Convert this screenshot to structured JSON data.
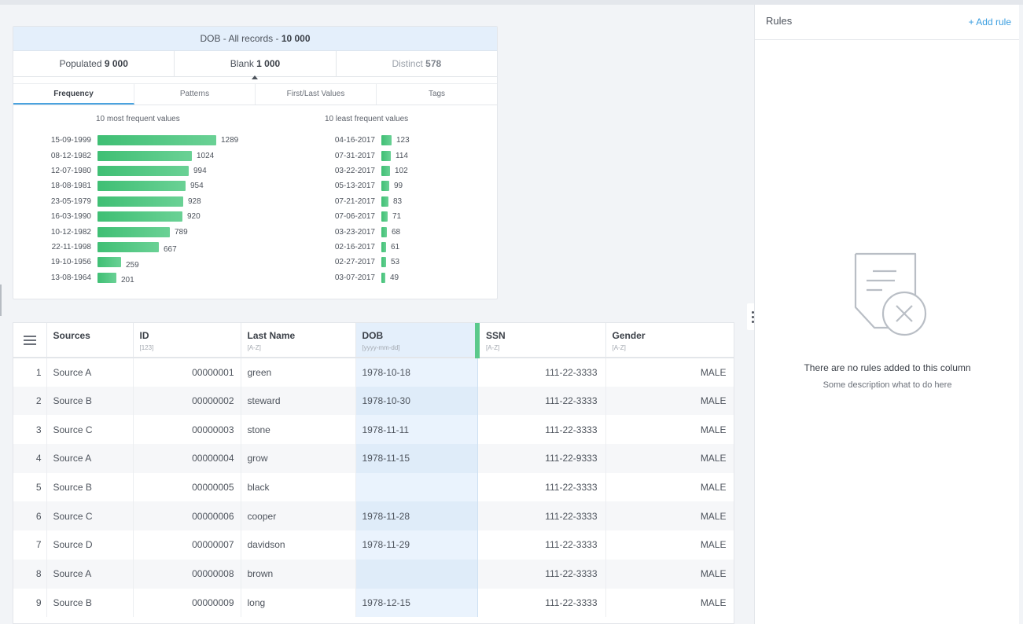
{
  "profile": {
    "title_prefix": "DOB - All records - ",
    "title_count": "10 000",
    "stats": {
      "populated_label": "Populated ",
      "populated_value": "9 000",
      "blank_label": "Blank ",
      "blank_value": "1 000",
      "distinct_label": "Distinct ",
      "distinct_value": "578"
    },
    "tabs": [
      "Frequency",
      "Patterns",
      "First/Last Values",
      "Tags"
    ],
    "most_title": "10 most frequent values",
    "least_title": "10 least frequent values",
    "most": [
      {
        "label": "15-09-1999",
        "value": 1289
      },
      {
        "label": "08-12-1982",
        "value": 1024
      },
      {
        "label": "12-07-1980",
        "value": 994
      },
      {
        "label": "18-08-1981",
        "value": 954
      },
      {
        "label": "23-05-1979",
        "value": 928
      },
      {
        "label": "16-03-1990",
        "value": 920
      },
      {
        "label": "10-12-1982",
        "value": 789
      },
      {
        "label": "22-11-1998",
        "value": 667
      },
      {
        "label": "19-10-1956",
        "value": 259
      },
      {
        "label": "13-08-1964",
        "value": 201
      }
    ],
    "least": [
      {
        "label": "04-16-2017",
        "value": 123
      },
      {
        "label": "07-31-2017",
        "value": 114
      },
      {
        "label": "03-22-2017",
        "value": 102
      },
      {
        "label": "05-13-2017",
        "value": 99
      },
      {
        "label": "07-21-2017",
        "value": 83
      },
      {
        "label": "07-06-2017",
        "value": 71
      },
      {
        "label": "03-23-2017",
        "value": 68
      },
      {
        "label": "02-16-2017",
        "value": 61
      },
      {
        "label": "02-27-2017",
        "value": 53
      },
      {
        "label": "03-07-2017",
        "value": 49
      }
    ]
  },
  "table": {
    "columns": [
      {
        "name": "Sources",
        "sub": ""
      },
      {
        "name": "ID",
        "sub": "[123]"
      },
      {
        "name": "Last Name",
        "sub": "[A-Z]"
      },
      {
        "name": "DOB",
        "sub": "[yyyy-mm-dd]"
      },
      {
        "name": "SSN",
        "sub": "[A-Z]"
      },
      {
        "name": "Gender",
        "sub": "[A-Z]"
      }
    ],
    "rows": [
      {
        "n": "1",
        "source": "Source A",
        "id": "00000001",
        "last": "green",
        "dob": "1978-10-18",
        "ssn": "111-22-3333",
        "gender": "MALE"
      },
      {
        "n": "2",
        "source": "Source B",
        "id": "00000002",
        "last": "steward",
        "dob": "1978-10-30",
        "ssn": "111-22-3333",
        "gender": "MALE"
      },
      {
        "n": "3",
        "source": "Source C",
        "id": "00000003",
        "last": "stone",
        "dob": "1978-11-11",
        "ssn": "111-22-3333",
        "gender": "MALE"
      },
      {
        "n": "4",
        "source": "Source A",
        "id": "00000004",
        "last": "grow",
        "dob": "1978-11-15",
        "ssn": "111-22-9333",
        "gender": "MALE"
      },
      {
        "n": "5",
        "source": "Source B",
        "id": "00000005",
        "last": "black",
        "dob": "",
        "ssn": "111-22-3333",
        "gender": "MALE"
      },
      {
        "n": "6",
        "source": "Source C",
        "id": "00000006",
        "last": "cooper",
        "dob": "1978-11-28",
        "ssn": "111-22-3333",
        "gender": "MALE"
      },
      {
        "n": "7",
        "source": "Source D",
        "id": "00000007",
        "last": "davidson",
        "dob": "1978-11-29",
        "ssn": "111-22-3333",
        "gender": "MALE"
      },
      {
        "n": "8",
        "source": "Source A",
        "id": "00000008",
        "last": "brown",
        "dob": "",
        "ssn": "111-22-3333",
        "gender": "MALE"
      },
      {
        "n": "9",
        "source": "Source B",
        "id": "00000009",
        "last": "long",
        "dob": "1978-12-15",
        "ssn": "111-22-3333",
        "gender": "MALE"
      }
    ]
  },
  "rules": {
    "title": "Rules",
    "add_label": "+ Add rule",
    "empty_title": "There are no rules added to this column",
    "empty_desc": "Some description what to do here"
  },
  "colors": {
    "accent": "#3a9ee0",
    "bar": "#3fbf74",
    "selected_column": "#e4effb"
  }
}
